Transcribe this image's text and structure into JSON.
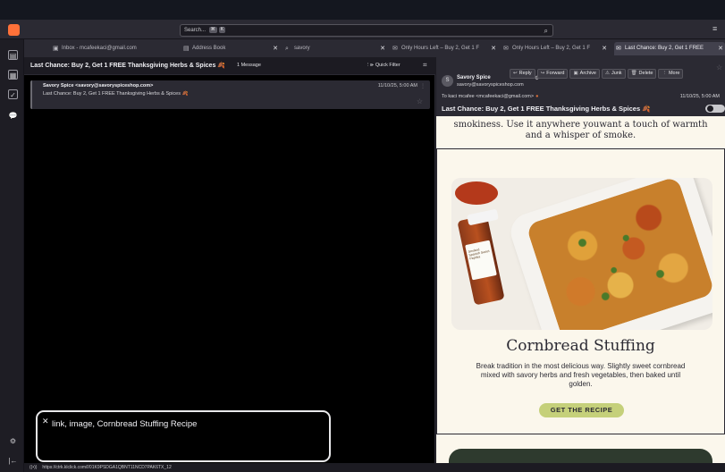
{
  "toolbar": {
    "search_placeholder": "Search...",
    "search_kbd_1": "⌘",
    "search_kbd_2": "K"
  },
  "tabs": [
    {
      "label": "Inbox - mcafeekaci@gmail.com"
    },
    {
      "label": "Address Book"
    },
    {
      "label": "savory"
    },
    {
      "label": "Only Hours Left – Buy 2, Get 1 F"
    },
    {
      "label": "Only Hours Left – Buy 2, Get 1 F"
    },
    {
      "label": "Last Chance: Buy 2, Get 1 FREE"
    }
  ],
  "thread": {
    "title": "Last Chance: Buy 2, Get 1 FREE Thanksgiving Herbs & Spices",
    "count": "1 Message",
    "quick_filter": "Quick Filter",
    "row": {
      "from": "Savory Spice <savory@savoryspiceshop.com>",
      "date": "11/10/25, 5:00 AM",
      "subject": "Last Chance: Buy 2, Get 1 FREE Thanksgiving Herbs & Spices"
    }
  },
  "tooltip": {
    "text": "link, image, Cornbread Stuffing Recipe"
  },
  "status": {
    "url": "https://ctrk.klclick.com/l/01K9PSDGA1QBNT11NCD7PAK6TX_12"
  },
  "reader": {
    "avatar_letter": "S",
    "sender_name": "Savory Spice",
    "sender_email": "savory@savoryspiceshop.com",
    "actions": [
      "Reply",
      "Forward",
      "Archive",
      "Junk",
      "Delete",
      "More"
    ],
    "to_line": "To  kaci mcafee <mcafeekaci@gmail.com>",
    "date": "11/10/25, 5:00 AM",
    "subject": "Last Chance: Buy 2, Get 1 FREE Thanksgiving Herbs & Spices"
  },
  "email": {
    "top_text_1": "smokiness. Use it anywhere youwant a touch of warmth",
    "top_text_2": "and a whisper of smoke.",
    "jar_label": "Smoked Spanish Sweet Paprika",
    "recipe_title": "Cornbread Stuffing",
    "recipe_desc": "Break tradition in the most delicious way. Slightly sweet cornbread mixed with savory herbs and fresh vegetables, then baked until golden.",
    "cta_label": "GET THE RECIPE"
  }
}
